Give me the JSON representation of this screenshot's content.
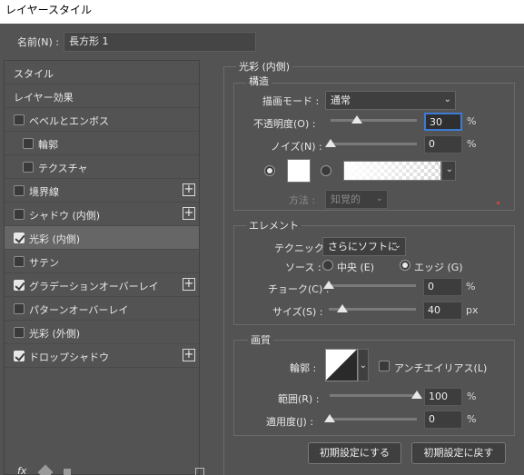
{
  "window": {
    "title": "レイヤースタイル"
  },
  "name_field": {
    "label": "名前(N) :",
    "value": "長方形 1"
  },
  "sidebar": {
    "items": [
      {
        "label": "スタイル",
        "has_cb": false,
        "checked": false,
        "plus": false,
        "indent": 0,
        "selected": false
      },
      {
        "label": "レイヤー効果",
        "has_cb": false,
        "checked": false,
        "plus": false,
        "indent": 0,
        "selected": false
      },
      {
        "label": "ベベルとエンボス",
        "has_cb": true,
        "checked": false,
        "plus": false,
        "indent": 0,
        "selected": false
      },
      {
        "label": "輪郭",
        "has_cb": true,
        "checked": false,
        "plus": false,
        "indent": 1,
        "selected": false
      },
      {
        "label": "テクスチャ",
        "has_cb": true,
        "checked": false,
        "plus": false,
        "indent": 1,
        "selected": false
      },
      {
        "label": "境界線",
        "has_cb": true,
        "checked": false,
        "plus": true,
        "indent": 0,
        "selected": false
      },
      {
        "label": "シャドウ (内側)",
        "has_cb": true,
        "checked": false,
        "plus": true,
        "indent": 0,
        "selected": false
      },
      {
        "label": "光彩 (内側)",
        "has_cb": true,
        "checked": true,
        "plus": false,
        "indent": 0,
        "selected": true
      },
      {
        "label": "サテン",
        "has_cb": true,
        "checked": false,
        "plus": false,
        "indent": 0,
        "selected": false
      },
      {
        "label": "グラデーションオーバーレイ",
        "has_cb": true,
        "checked": true,
        "plus": true,
        "indent": 0,
        "selected": false
      },
      {
        "label": "パターンオーバーレイ",
        "has_cb": true,
        "checked": false,
        "plus": false,
        "indent": 0,
        "selected": false
      },
      {
        "label": "光彩 (外側)",
        "has_cb": true,
        "checked": false,
        "plus": false,
        "indent": 0,
        "selected": false
      },
      {
        "label": "ドロップシャドウ",
        "has_cb": true,
        "checked": true,
        "plus": true,
        "indent": 0,
        "selected": false
      }
    ],
    "footer_icon_fx": "fx"
  },
  "panel": {
    "title": "光彩 (内側)",
    "structure": {
      "title": "構造",
      "blend_label": "描画モード :",
      "blend_value": "通常",
      "opacity_label": "不透明度(O) :",
      "opacity_value": "30",
      "opacity_unit": "%",
      "opacity_level": 0.3,
      "noise_label": "ノイズ(N) :",
      "noise_value": "0",
      "noise_unit": "%",
      "noise_level": 0,
      "method_label": "方法 :",
      "method_value": "知覚的"
    },
    "elements": {
      "title": "エレメント",
      "technique_label": "テクニック :",
      "technique_value": "さらにソフトに",
      "source_label": "ソース :",
      "source_center": "中央 (E)",
      "source_edge": "エッジ (G)",
      "choke_label": "チョーク(C) :",
      "choke_value": "0",
      "choke_unit": "%",
      "choke_level": 0,
      "size_label": "サイズ(S) :",
      "size_value": "40",
      "size_unit": "px",
      "size_level": 0.16
    },
    "quality": {
      "title": "画質",
      "contour_label": "輪郭 :",
      "antialias_label": "アンチエイリアス(L)",
      "range_label": "範囲(R) :",
      "range_value": "100",
      "range_unit": "%",
      "range_level": 1.0,
      "jitter_label": "適用度(J) :",
      "jitter_value": "0",
      "jitter_unit": "%",
      "jitter_level": 0
    },
    "buttons": {
      "default": "初期設定にする",
      "reset": "初期設定に戻す"
    }
  }
}
